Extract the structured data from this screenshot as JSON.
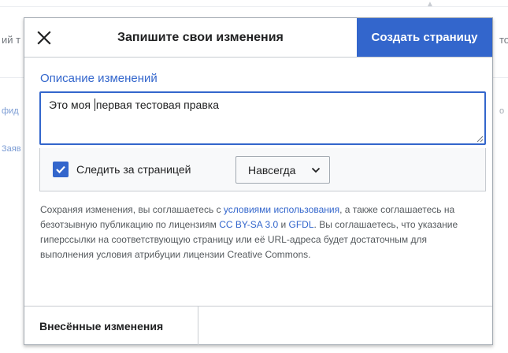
{
  "background": {
    "left_texts": [
      "ий т",
      "фид",
      "Заяв"
    ],
    "right_texts": [
      "то",
      "о"
    ],
    "scroll_arrow": "▲"
  },
  "dialog": {
    "title": "Запишите свои изменения",
    "close_icon": "close-icon",
    "primary_action": "Создать страницу",
    "summary": {
      "label": "Описание изменений",
      "value_before_caret": "Это моя ",
      "value_after_caret": "первая тестовая правка"
    },
    "keyboard_icon": "keyboard-icon",
    "watch": {
      "checked": true,
      "label": "Следить за страницей",
      "expiry_value": "Навсегда"
    },
    "license": {
      "t1": "Сохраняя изменения, вы соглашаетесь с ",
      "link_terms": "условиями использования",
      "t2": ", а также соглашаетесь на безотзывную публикацию по лицензиям ",
      "link_cc": "CC BY-SA 3.0",
      "t3": " и ",
      "link_gfdl": "GFDL",
      "t4": ". Вы соглашаетесь, что указание гиперссылки на соответствующую страницу или её URL-адреса будет достаточным для выполнения условия атрибуции лицензии Creative Commons."
    },
    "footer": {
      "changes_tab": "Внесённые изменения"
    }
  },
  "colors": {
    "accent": "#3366cc",
    "border": "#a2a9b1",
    "text": "#202122",
    "muted": "#54595d"
  }
}
